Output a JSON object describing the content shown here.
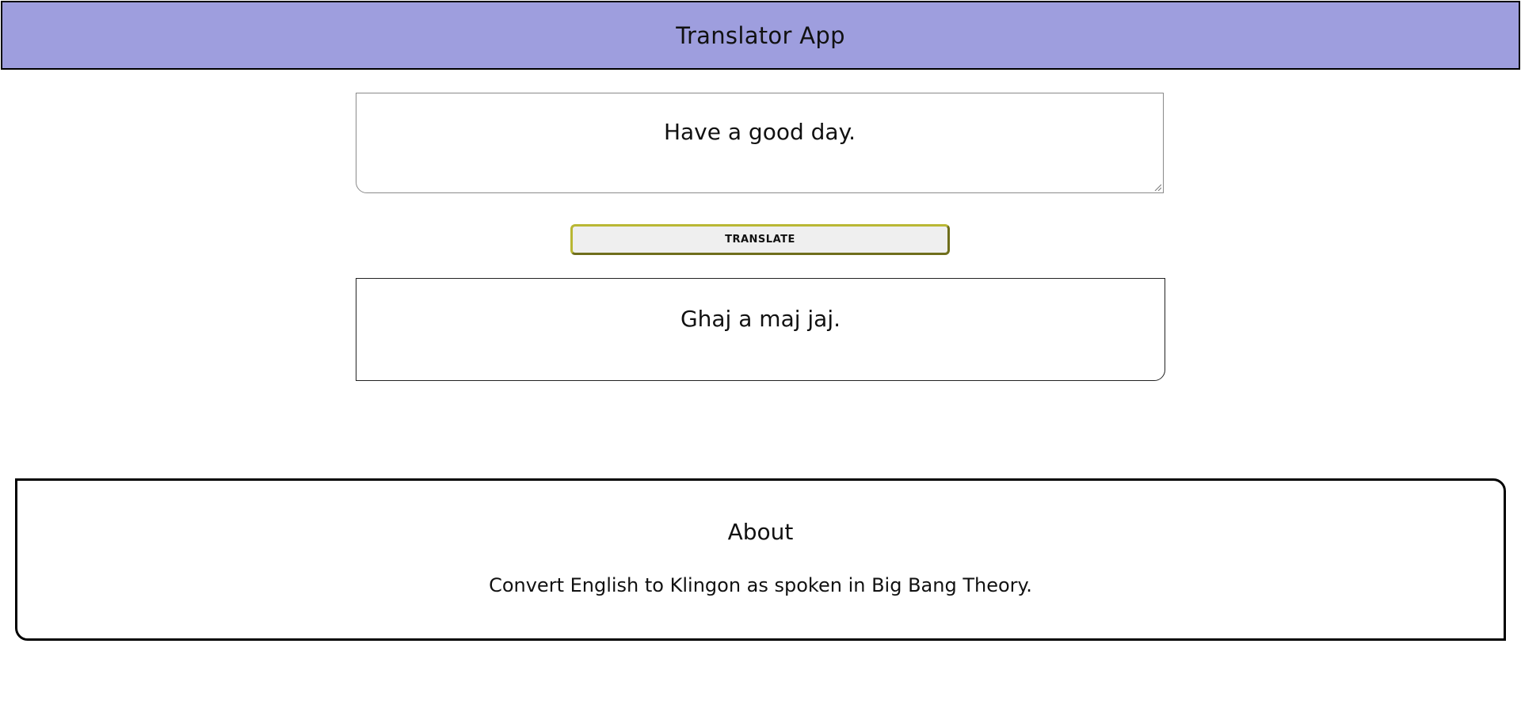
{
  "header": {
    "title": "Translator App",
    "background_color": "#9e9ede"
  },
  "input": {
    "value": "Have a good day."
  },
  "translate_button": {
    "label": "TRANSLATE",
    "border_color": "#b9b734"
  },
  "output": {
    "value": "Ghaj a maj jaj."
  },
  "about": {
    "heading": "About",
    "description": "Convert English to Klingon as spoken in Big Bang Theory."
  }
}
